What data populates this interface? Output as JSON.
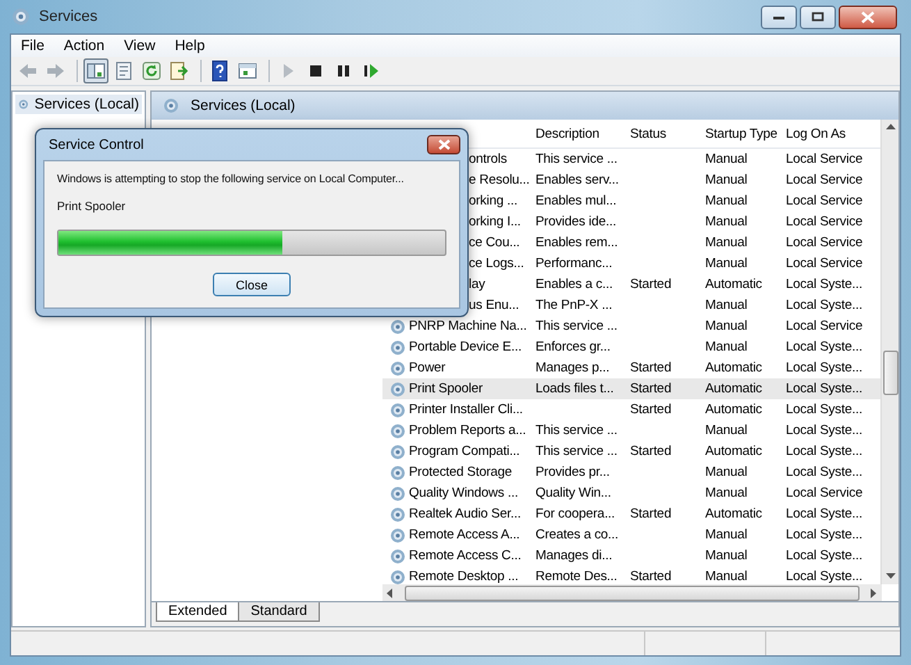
{
  "window": {
    "title": "Services"
  },
  "menu": [
    "File",
    "Action",
    "View",
    "Help"
  ],
  "toolbar": [
    {
      "kind": "back",
      "disabled": true,
      "pressed": false
    },
    {
      "kind": "forward",
      "disabled": true,
      "pressed": false
    },
    {
      "kind": "separator"
    },
    {
      "kind": "tree",
      "disabled": false,
      "pressed": true
    },
    {
      "kind": "properties",
      "disabled": false,
      "pressed": false
    },
    {
      "kind": "refresh",
      "disabled": false,
      "pressed": false
    },
    {
      "kind": "export",
      "disabled": false,
      "pressed": false
    },
    {
      "kind": "separator"
    },
    {
      "kind": "help",
      "disabled": false,
      "pressed": false
    },
    {
      "kind": "console",
      "disabled": false,
      "pressed": false
    },
    {
      "kind": "separator"
    },
    {
      "kind": "play",
      "disabled": true,
      "pressed": false
    },
    {
      "kind": "stop",
      "disabled": false,
      "pressed": false
    },
    {
      "kind": "pause",
      "disabled": false,
      "pressed": false
    },
    {
      "kind": "restart",
      "disabled": false,
      "pressed": false
    }
  ],
  "tree": {
    "items": [
      {
        "label": "Services (Local)",
        "selected": true
      }
    ]
  },
  "pane": {
    "title": "Services (Local)"
  },
  "table": {
    "columns": [
      "Description",
      "Status",
      "Startup Type",
      "Log On As"
    ],
    "rows": [
      {
        "kind": "covered",
        "name": "ontrols",
        "description": "This service ...",
        "startup_type": "Manual",
        "log_on_as": "Local Service",
        "selected": false
      },
      {
        "kind": "covered",
        "name": "e Resolu...",
        "description": "Enables serv...",
        "startup_type": "Manual",
        "log_on_as": "Local Service",
        "selected": false
      },
      {
        "kind": "covered",
        "name": "orking ...",
        "description": "Enables mul...",
        "startup_type": "Manual",
        "log_on_as": "Local Service",
        "selected": false
      },
      {
        "kind": "covered",
        "name": "orking I...",
        "description": "Provides ide...",
        "startup_type": "Manual",
        "log_on_as": "Local Service",
        "selected": false
      },
      {
        "kind": "covered",
        "name": "ce Cou...",
        "description": "Enables rem...",
        "startup_type": "Manual",
        "log_on_as": "Local Service",
        "selected": false
      },
      {
        "kind": "covered",
        "name": "ce Logs...",
        "description": "Performanc...",
        "startup_type": "Manual",
        "log_on_as": "Local Service",
        "selected": false
      },
      {
        "kind": "covered",
        "name": "lay",
        "description": "Enables a c...",
        "status": "Started",
        "startup_type": "Automatic",
        "log_on_as": "Local Syste...",
        "selected": false
      },
      {
        "kind": "covered",
        "name": "us Enu...",
        "description": "The PnP-X ...",
        "startup_type": "Manual",
        "log_on_as": "Local Syste...",
        "selected": false
      },
      {
        "kind": "full",
        "name": "PNRP Machine Na...",
        "description": "This service ...",
        "startup_type": "Manual",
        "log_on_as": "Local Service",
        "selected": false
      },
      {
        "kind": "full",
        "name": "Portable Device E...",
        "description": "Enforces gr...",
        "startup_type": "Manual",
        "log_on_as": "Local Syste...",
        "selected": false
      },
      {
        "kind": "full",
        "name": "Power",
        "description": "Manages p...",
        "status": "Started",
        "startup_type": "Automatic",
        "log_on_as": "Local Syste...",
        "selected": false
      },
      {
        "kind": "full",
        "name": "Print Spooler",
        "description": "Loads files t...",
        "status": "Started",
        "startup_type": "Automatic",
        "log_on_as": "Local Syste...",
        "selected": true
      },
      {
        "kind": "full",
        "name": "Printer Installer Cli...",
        "status": "Started",
        "startup_type": "Automatic",
        "log_on_as": "Local Syste...",
        "selected": false
      },
      {
        "kind": "full",
        "name": "Problem Reports a...",
        "description": "This service ...",
        "startup_type": "Manual",
        "log_on_as": "Local Syste...",
        "selected": false
      },
      {
        "kind": "full",
        "name": "Program Compati...",
        "description": "This service ...",
        "status": "Started",
        "startup_type": "Automatic",
        "log_on_as": "Local Syste...",
        "selected": false
      },
      {
        "kind": "full",
        "name": "Protected Storage",
        "description": "Provides pr...",
        "startup_type": "Manual",
        "log_on_as": "Local Syste...",
        "selected": false
      },
      {
        "kind": "full",
        "name": "Quality Windows ...",
        "description": "Quality Win...",
        "startup_type": "Manual",
        "log_on_as": "Local Service",
        "selected": false
      },
      {
        "kind": "full",
        "name": "Realtek Audio Ser...",
        "description": "For coopera...",
        "status": "Started",
        "startup_type": "Automatic",
        "log_on_as": "Local Syste...",
        "selected": false
      },
      {
        "kind": "full",
        "name": "Remote Access A...",
        "description": "Creates a co...",
        "startup_type": "Manual",
        "log_on_as": "Local Syste...",
        "selected": false
      },
      {
        "kind": "full",
        "name": "Remote Access C...",
        "description": "Manages di...",
        "startup_type": "Manual",
        "log_on_as": "Local Syste...",
        "selected": false
      },
      {
        "kind": "full",
        "name": "Remote Desktop ...",
        "description": "Remote Des...",
        "status": "Started",
        "startup_type": "Manual",
        "log_on_as": "Local Syste...",
        "selected": false
      }
    ]
  },
  "tabs": [
    {
      "label": "Extended",
      "selected": true
    },
    {
      "label": "Standard",
      "selected": false
    }
  ],
  "dialog": {
    "title": "Service Control",
    "message": "Windows is attempting to stop the following service on Local Computer...",
    "service": "Print Spooler",
    "progress": {
      "level": 0.58
    },
    "button": "Close"
  }
}
